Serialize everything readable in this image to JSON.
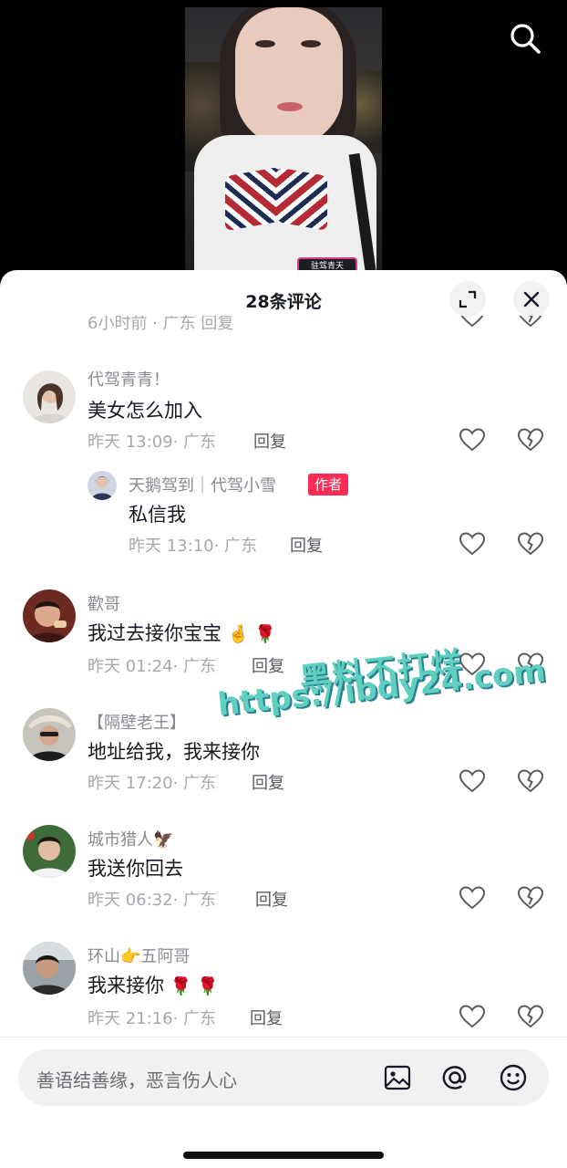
{
  "header": {
    "comment_count_title": "28条评论"
  },
  "video": {
    "badge_text": "驻驾青天"
  },
  "partial_row": {
    "text": "6小时前 · 广东    回复"
  },
  "comments": [
    {
      "username": "代驾青青！",
      "text": "美女怎么加入",
      "time_location": "昨天 13:09· 广东",
      "reply_label": "回复"
    },
    {
      "username": "天鹅驾到｜代驾小雪",
      "author_tag": "作者",
      "text": "私信我",
      "time_location": "昨天 13:10· 广东",
      "reply_label": "回复"
    },
    {
      "username": "歡哥",
      "text": "我过去接你宝宝",
      "emojis": "🤞 🌹",
      "time_location": "昨天 01:24· 广东",
      "reply_label": "回复"
    },
    {
      "username": "【隔壁老王】",
      "text": "地址给我，我来接你",
      "time_location": "昨天 17:20· 广东",
      "reply_label": "回复"
    },
    {
      "username": "城市猎人🦅",
      "text": "我送你回去",
      "time_location": "昨天 06:32· 广东",
      "reply_label": "回复"
    },
    {
      "username": "环山👉五阿哥",
      "text": "我来接你",
      "emojis": "🌹 🌹",
      "time_location": "昨天 21:16· 广东",
      "reply_label": "回复"
    }
  ],
  "watermark": {
    "line1": "黑料不打烊",
    "line2": "https://ibdy24.com"
  },
  "input": {
    "placeholder": "善语结善缘，恶言伤人心"
  },
  "icons": {
    "search": "search-icon",
    "expand": "expand-icon",
    "close": "close-icon",
    "like": "heart-icon",
    "dislike": "broken-heart-icon",
    "image": "image-icon",
    "mention": "at-icon",
    "emoji": "emoji-icon"
  },
  "colors": {
    "author_tag": "#fe2c55",
    "watermark": "#5fd0c0"
  }
}
